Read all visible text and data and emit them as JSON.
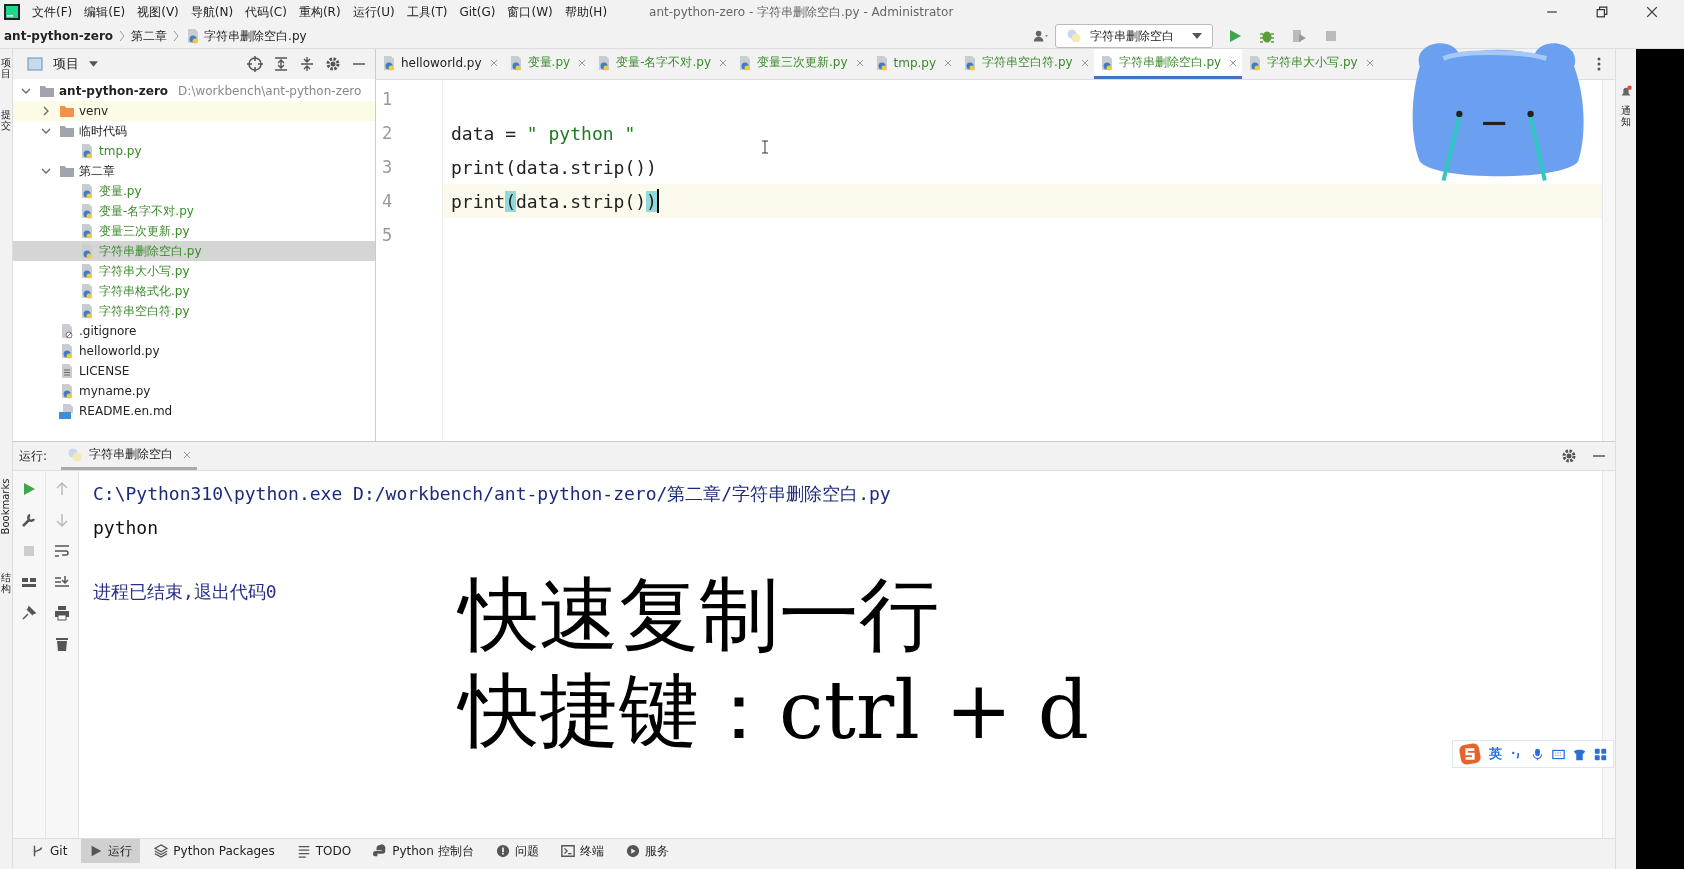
{
  "menu": [
    "文件(F)",
    "编辑(E)",
    "视图(V)",
    "导航(N)",
    "代码(C)",
    "重构(R)",
    "运行(U)",
    "工具(T)",
    "Git(G)",
    "窗口(W)",
    "帮助(H)"
  ],
  "window": {
    "title": "ant-python-zero - 字符串删除空白.py - Administrator"
  },
  "breadcrumb": [
    "ant-python-zero",
    "第二章",
    "字符串删除空白.py"
  ],
  "toolbar": {
    "run_config": "字符串删除空白"
  },
  "left_stripe": [
    {
      "label": "项目",
      "kind": "cjk"
    },
    {
      "label": "提交",
      "kind": "cjk"
    },
    {
      "label": "Bookmarks",
      "kind": "latin"
    },
    {
      "label": "结构",
      "kind": "cjk"
    }
  ],
  "right_stripe": [
    {
      "label": "通知"
    }
  ],
  "project": {
    "title": "项目",
    "tree": [
      {
        "name": "ant-python-zero",
        "path": "D:\\workbench\\ant-python-zero",
        "kind": "folder",
        "expanded": true,
        "selected": false,
        "children": [
          {
            "name": "venv",
            "kind": "excluded",
            "expanded": false,
            "selected": false
          },
          {
            "name": "临时代码",
            "kind": "folder",
            "expanded": true,
            "selected": false,
            "children": [
              {
                "name": "tmp.py",
                "kind": "python",
                "added": true,
                "selected": false
              }
            ]
          },
          {
            "name": "第二章",
            "kind": "folder",
            "expanded": true,
            "selected": false,
            "children": [
              {
                "name": "变量.py",
                "kind": "python",
                "added": true,
                "selected": false
              },
              {
                "name": "变量-名字不对.py",
                "kind": "python",
                "added": true,
                "selected": false
              },
              {
                "name": "变量三次更新.py",
                "kind": "python",
                "added": true,
                "selected": false
              },
              {
                "name": "字符串删除空白.py",
                "kind": "python",
                "added": true,
                "selected": true
              },
              {
                "name": "字符串大小写.py",
                "kind": "python",
                "added": true,
                "selected": false
              },
              {
                "name": "字符串格式化.py",
                "kind": "python",
                "added": true,
                "selected": false
              },
              {
                "name": "字符串空白符.py",
                "kind": "python",
                "added": true,
                "selected": false
              }
            ]
          },
          {
            "name": ".gitignore",
            "kind": "ignore",
            "added": false,
            "selected": false
          },
          {
            "name": "helloworld.py",
            "kind": "python",
            "added": false,
            "selected": false
          },
          {
            "name": "LICENSE",
            "kind": "text",
            "added": false,
            "selected": false
          },
          {
            "name": "myname.py",
            "kind": "python",
            "added": false,
            "selected": false
          },
          {
            "name": "README.en.md",
            "kind": "markdown",
            "added": false,
            "selected": false
          }
        ]
      }
    ]
  },
  "editor": {
    "tabs": [
      {
        "label": "helloworld.py",
        "added": false,
        "selected": false
      },
      {
        "label": "变量.py",
        "added": true,
        "selected": false
      },
      {
        "label": "变量-名字不对.py",
        "added": true,
        "selected": false
      },
      {
        "label": "变量三次更新.py",
        "added": true,
        "selected": false
      },
      {
        "label": "tmp.py",
        "added": true,
        "selected": false
      },
      {
        "label": "字符串空白符.py",
        "added": true,
        "selected": false
      },
      {
        "label": "字符串删除空白.py",
        "added": true,
        "selected": true
      },
      {
        "label": "字符串大小写.py",
        "added": true,
        "selected": false
      }
    ],
    "lines": [
      {
        "number": "1",
        "current": false
      },
      {
        "number": "2",
        "current": false,
        "tokens": [
          {
            "kind": "plain",
            "text": "data = "
          },
          {
            "kind": "string",
            "text": "\" python \""
          }
        ]
      },
      {
        "number": "3",
        "current": false,
        "tokens": [
          {
            "kind": "plain",
            "text": "print(data.strip())"
          }
        ]
      },
      {
        "number": "4",
        "current": true,
        "tokens": [
          {
            "kind": "plain",
            "text": "print"
          },
          {
            "kind": "brace",
            "text": "("
          },
          {
            "kind": "plain",
            "text": "data.strip()"
          },
          {
            "kind": "brace",
            "text": ")"
          }
        ]
      },
      {
        "number": "5",
        "current": false
      }
    ]
  },
  "run": {
    "label": "运行:",
    "tab": "字符串删除空白",
    "console": [
      {
        "kind": "command",
        "text": "C:\\Python310\\python.exe D:/workbench/ant-python-zero/第二章/字符串删除空白.py"
      },
      {
        "kind": "output",
        "text": "python"
      },
      {
        "kind": "exit",
        "text": "进程已结束,退出代码0"
      }
    ]
  },
  "caption": [
    "快速复制一行",
    "快捷键：ctrl + d"
  ],
  "ime": {
    "mode": "英"
  },
  "bottom_tools": [
    {
      "label": "Git",
      "kind": "git",
      "selected": false
    },
    {
      "label": "运行",
      "kind": "run",
      "selected": true
    },
    {
      "label": "Python Packages",
      "kind": "packages",
      "selected": false
    },
    {
      "label": "TODO",
      "kind": "todo",
      "selected": false
    },
    {
      "label": "Python 控制台",
      "kind": "console",
      "selected": false
    },
    {
      "label": "问题",
      "kind": "problems",
      "selected": false
    },
    {
      "label": "终端",
      "kind": "terminal",
      "selected": false
    },
    {
      "label": "服务",
      "kind": "services",
      "selected": false
    }
  ]
}
